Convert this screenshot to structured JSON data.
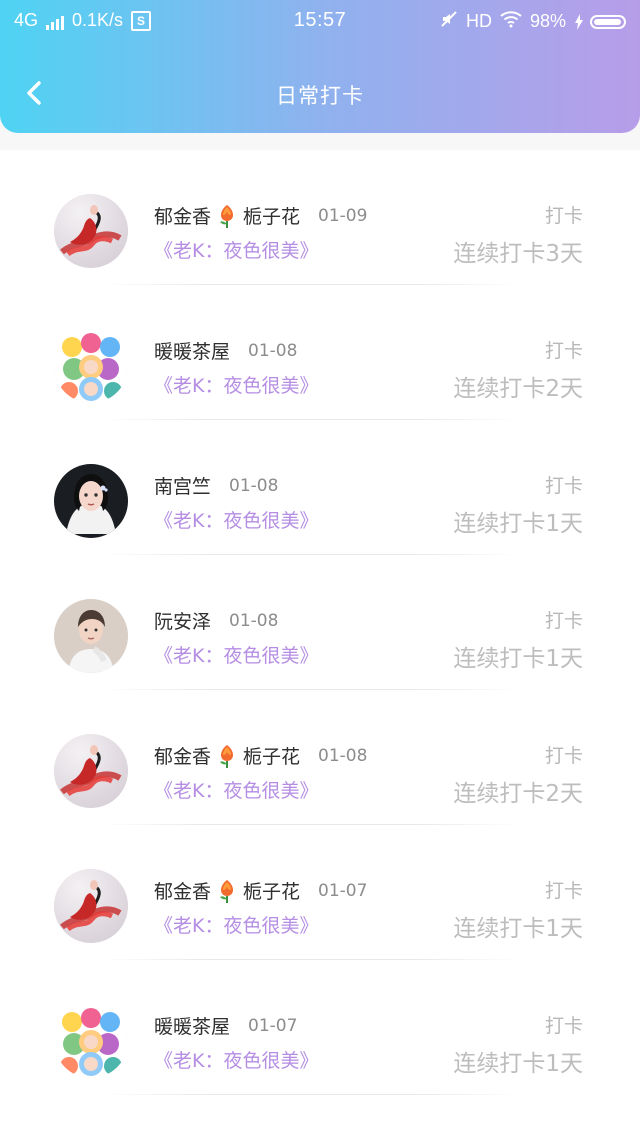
{
  "status_bar": {
    "network": "4G",
    "speed": "0.1K/s",
    "carrier_icon_text": "S",
    "time": "15:57",
    "hd": "HD",
    "battery": "98%"
  },
  "nav": {
    "title": "日常打卡",
    "back_icon": "chevron-left-icon"
  },
  "rows": [
    {
      "name": "郁金香",
      "name_suffix": "栀子花",
      "date": "01-09",
      "book": "《老K：夜色很美》",
      "action": "打卡",
      "streak": "连续打卡3天",
      "emoji": "tulip-icon",
      "avatar_icon": "red-dress-avatar"
    },
    {
      "name": "暖暖茶屋",
      "name_suffix": "",
      "date": "01-08",
      "book": "《老K：夜色很美》",
      "action": "打卡",
      "streak": "连续打卡2天",
      "emoji": "",
      "avatar_icon": "group-avatar"
    },
    {
      "name": "南宫竺",
      "name_suffix": "",
      "date": "01-08",
      "book": "《老K：夜色很美》",
      "action": "打卡",
      "streak": "连续打卡1天",
      "emoji": "",
      "avatar_icon": "woman-portrait-avatar"
    },
    {
      "name": "阮安泽",
      "name_suffix": "",
      "date": "01-08",
      "book": "《老K：夜色很美》",
      "action": "打卡",
      "streak": "连续打卡1天",
      "emoji": "",
      "avatar_icon": "man-portrait-avatar"
    },
    {
      "name": "郁金香",
      "name_suffix": "栀子花",
      "date": "01-08",
      "book": "《老K：夜色很美》",
      "action": "打卡",
      "streak": "连续打卡2天",
      "emoji": "tulip-icon",
      "avatar_icon": "red-dress-avatar"
    },
    {
      "name": "郁金香",
      "name_suffix": "栀子花",
      "date": "01-07",
      "book": "《老K：夜色很美》",
      "action": "打卡",
      "streak": "连续打卡1天",
      "emoji": "tulip-icon",
      "avatar_icon": "red-dress-avatar"
    },
    {
      "name": "暖暖茶屋",
      "name_suffix": "",
      "date": "01-07",
      "book": "《老K：夜色很美》",
      "action": "打卡",
      "streak": "连续打卡1天",
      "emoji": "",
      "avatar_icon": "group-avatar"
    }
  ],
  "colors": {
    "header_gradient": [
      "#4ed3f3",
      "#8fb2ee",
      "#b79de9"
    ],
    "book_purple": "#b58ee4",
    "muted_gray": "#bdbdbd"
  }
}
